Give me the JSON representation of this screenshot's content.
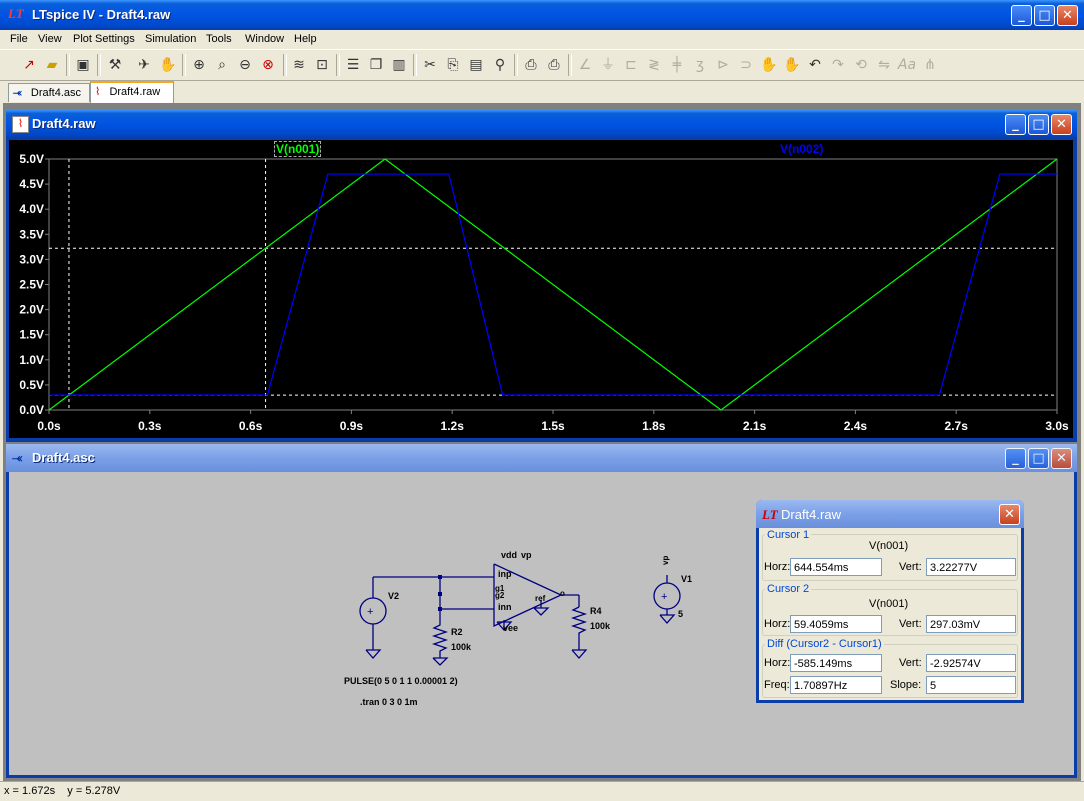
{
  "app": {
    "title": "LTspice IV - Draft4.raw",
    "logo": "LT"
  },
  "menu": [
    "File",
    "View",
    "Plot Settings",
    "Simulation",
    "Tools",
    "Window",
    "Help"
  ],
  "toolbar_icons": [
    "new-schematic-icon",
    "open-icon",
    "save-icon",
    "control-panel-icon",
    "run-icon",
    "pan-icon",
    "zoom-in-icon",
    "zoom-box-icon",
    "zoom-out-icon",
    "zoom-cancel-icon",
    "autorange-icon",
    "zoom-fit-icon",
    "tile-horizontal-icon",
    "cascade-icon",
    "tile-vertical-icon",
    "cut-icon",
    "copy-icon",
    "paste-icon",
    "find-icon",
    "print-preview-icon",
    "print-icon",
    "wire-icon",
    "ground-icon",
    "label-icon",
    "resistor-icon",
    "capacitor-icon",
    "inductor-icon",
    "diode-icon",
    "component-icon",
    "move-icon",
    "drag-icon",
    "undo-icon",
    "redo-icon",
    "rotate-icon",
    "mirror-icon",
    "text-icon",
    "spice-directive-icon"
  ],
  "tabs": [
    {
      "label": "Draft4.asc",
      "icon": "schematic-icon"
    },
    {
      "label": "Draft4.raw",
      "icon": "waveform-icon"
    }
  ],
  "plot_window": {
    "title": "Draft4.raw",
    "traces": [
      {
        "label": "V(n001)",
        "color": "#00ff00"
      },
      {
        "label": "V(n002)",
        "color": "#0000ff"
      }
    ]
  },
  "chart_data": {
    "type": "line",
    "xlim": [
      0,
      3.0
    ],
    "ylim": [
      0,
      5.0
    ],
    "x_ticks": [
      "0.0s",
      "0.3s",
      "0.6s",
      "0.9s",
      "1.2s",
      "1.5s",
      "1.8s",
      "2.1s",
      "2.4s",
      "2.7s",
      "3.0s"
    ],
    "y_ticks": [
      "0.0V",
      "0.5V",
      "1.0V",
      "1.5V",
      "2.0V",
      "2.5V",
      "3.0V",
      "3.5V",
      "4.0V",
      "4.5V",
      "5.0V"
    ],
    "series": [
      {
        "name": "V(n001)",
        "color": "#00ff00",
        "x": [
          0,
          1.0,
          2.0,
          3.0
        ],
        "y": [
          0,
          5.0,
          0,
          5.0
        ]
      },
      {
        "name": "V(n002)",
        "color": "#0000ff",
        "x": [
          0,
          0.65,
          0.83,
          1.19,
          1.35,
          2.65,
          2.83,
          3.0
        ],
        "y": [
          0.3,
          0.3,
          4.7,
          4.7,
          0.3,
          0.3,
          4.7,
          4.7
        ]
      }
    ],
    "cursors": {
      "c1": {
        "x": 0.644554,
        "y": 3.22277
      },
      "c2": {
        "x": 0.0594059,
        "y": 0.29703
      }
    }
  },
  "schematic_window": {
    "title": "Draft4.asc",
    "labels": {
      "v2": "V2",
      "v1": "V1",
      "r2": "R2",
      "r2_val": "100k",
      "r4": "R4",
      "r4_val": "100k",
      "vdd": "vdd",
      "vp": "vp",
      "vee": "vee",
      "inp": "inp",
      "inn": "inn",
      "g1": "g1",
      "g2": "g2",
      "ref": "ref",
      "o": "o",
      "vp_net": "vp",
      "v1_val": "5",
      "pulse": "PULSE(0 5 0 1 1 0.00001 2)",
      "tran": ".tran 0 3 0 1m"
    }
  },
  "cursor_panel": {
    "title": "Draft4.raw",
    "cursor1": {
      "group": "Cursor 1",
      "trace": "V(n001)",
      "horz_label": "Horz:",
      "horz": "644.554ms",
      "vert_label": "Vert:",
      "vert": "3.22277V"
    },
    "cursor2": {
      "group": "Cursor 2",
      "trace": "V(n001)",
      "horz_label": "Horz:",
      "horz": "59.4059ms",
      "vert_label": "Vert:",
      "vert": "297.03mV"
    },
    "diff": {
      "group": "Diff (Cursor2 - Cursor1)",
      "horz_label": "Horz:",
      "horz": "-585.149ms",
      "vert_label": "Vert:",
      "vert": "-2.92574V",
      "freq_label": "Freq:",
      "freq": "1.70897Hz",
      "slope_label": "Slope:",
      "slope": "5"
    }
  },
  "status": {
    "readout": "x = 1.672s    y = 5.278V"
  }
}
